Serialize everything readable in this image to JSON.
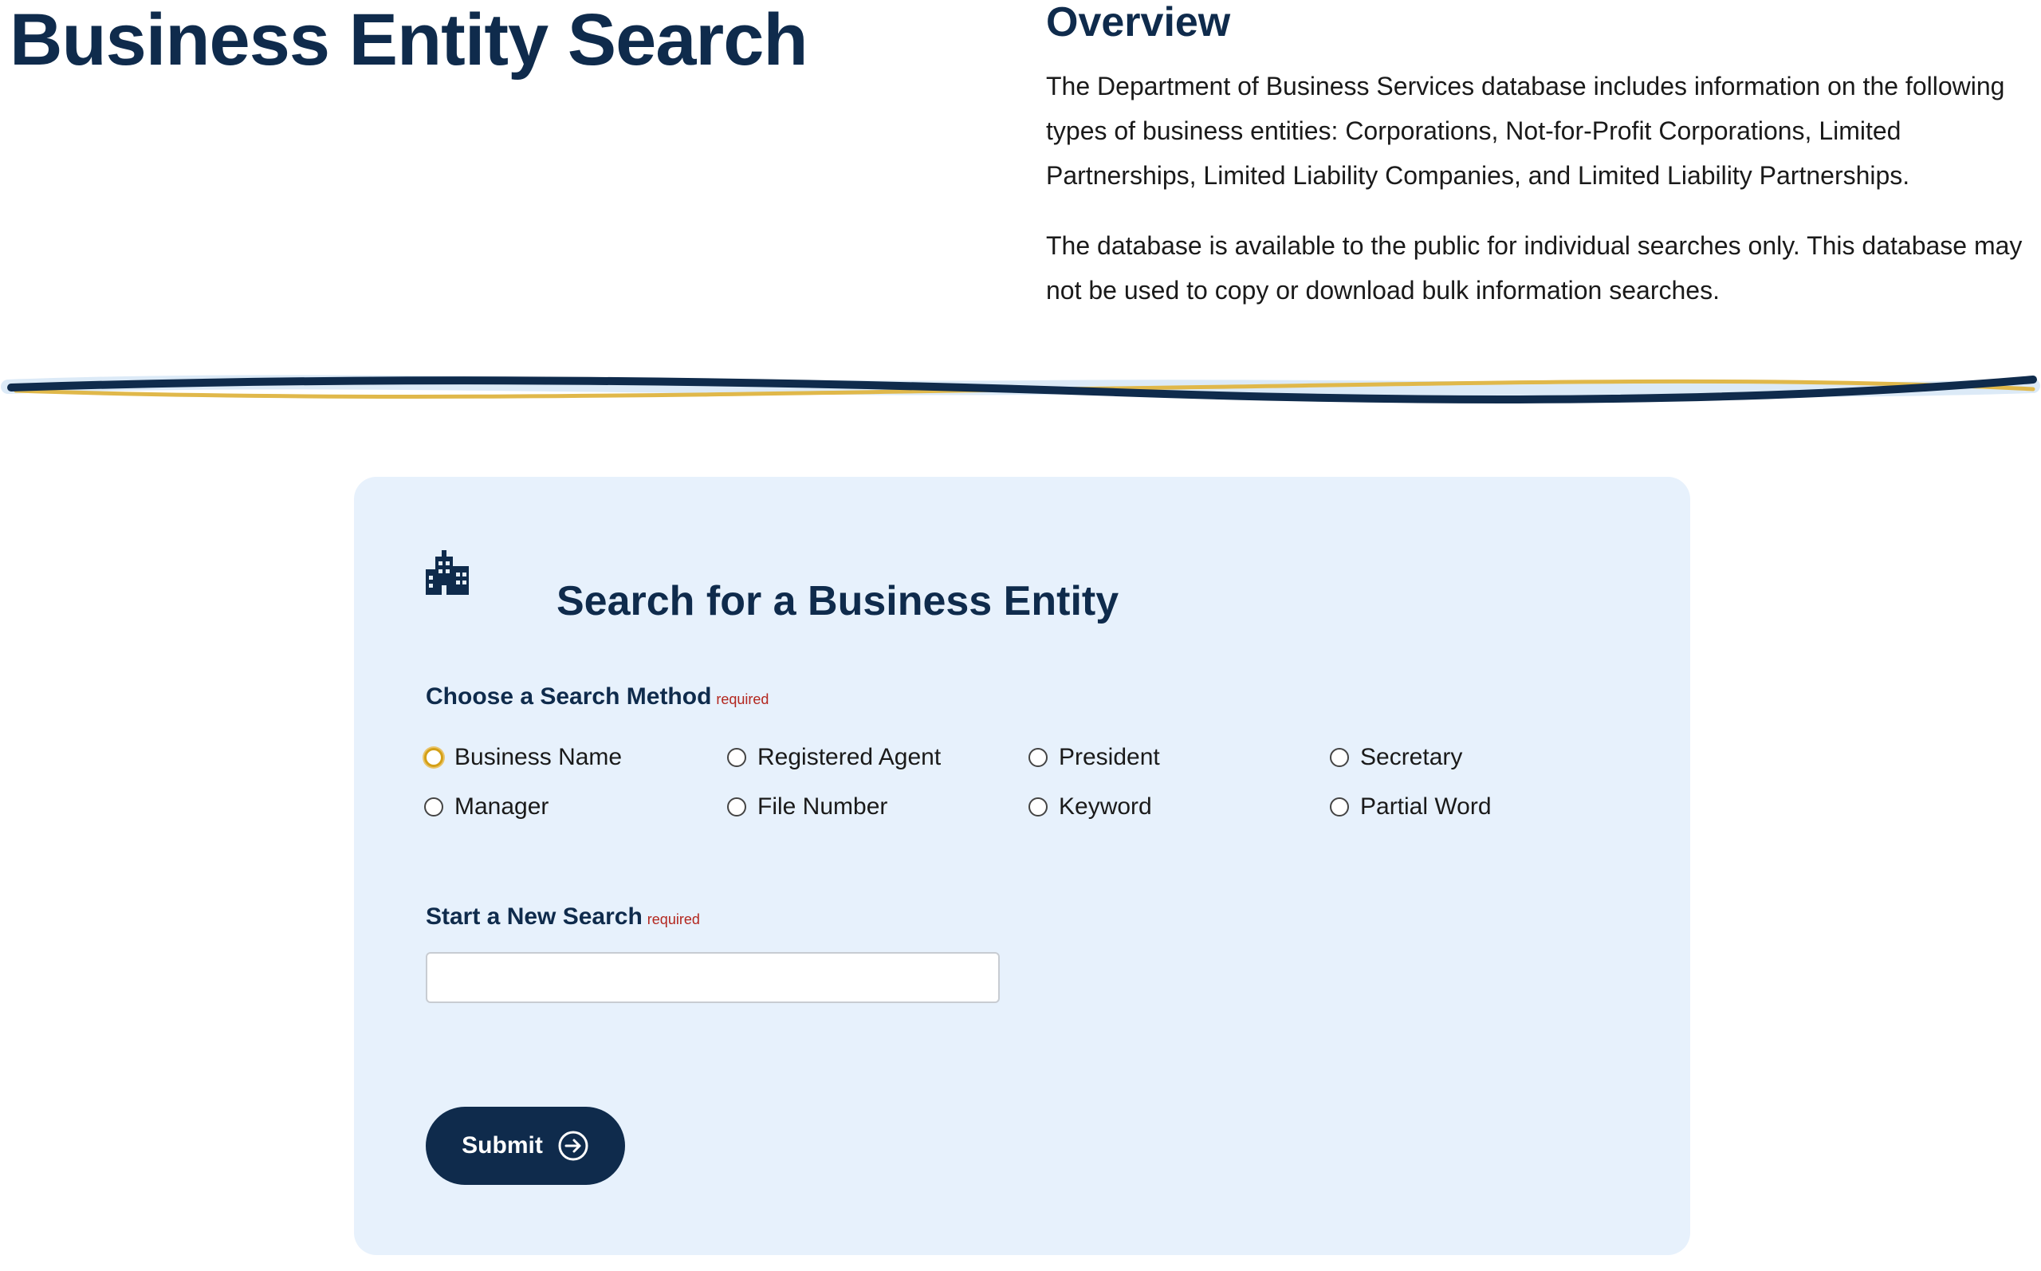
{
  "page": {
    "title": "Business Entity Search"
  },
  "overview": {
    "heading": "Overview",
    "paragraph1": "The Department of Business Services database includes information on the following types of business entities: Corporations, Not-for-Profit Corporations, Limited Partnerships, Limited Liability Companies, and Limited Liability Partnerships.",
    "paragraph2": "The database is available to the public for individual searches only. This database may not be used to copy or download bulk information searches."
  },
  "form": {
    "icon": "building-icon",
    "title": "Search for a Business Entity",
    "method_label": "Choose a Search Method",
    "method_required": "required",
    "methods": [
      {
        "label": "Business Name",
        "focused": true
      },
      {
        "label": "Registered Agent",
        "focused": false
      },
      {
        "label": "President",
        "focused": false
      },
      {
        "label": "Secretary",
        "focused": false
      },
      {
        "label": "Manager",
        "focused": false
      },
      {
        "label": "File Number",
        "focused": false
      },
      {
        "label": "Keyword",
        "focused": false
      },
      {
        "label": "Partial Word",
        "focused": false
      }
    ],
    "search_label": "Start a New Search",
    "search_required": "required",
    "search_value": "",
    "search_placeholder": "",
    "submit_label": "Submit",
    "submit_icon": "arrow-right-circle-icon"
  },
  "colors": {
    "navy": "#0f2b4c",
    "gold": "#e0b84a",
    "card_bg": "#e7f1fc",
    "required_red": "#b3261e"
  }
}
